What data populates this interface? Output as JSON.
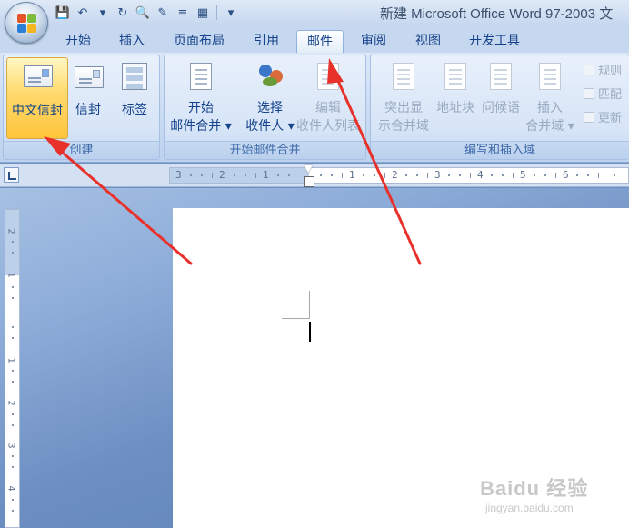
{
  "window": {
    "title": "新建 Microsoft Office Word 97-2003 文"
  },
  "quick_access": [
    {
      "icon": "save-icon",
      "glyph": "💾"
    },
    {
      "icon": "undo-icon",
      "glyph": "↶"
    },
    {
      "icon": "dropdown-arrow-icon",
      "glyph": "▾"
    },
    {
      "icon": "redo-icon",
      "glyph": "↻"
    },
    {
      "icon": "print-preview-icon",
      "glyph": "🔍"
    },
    {
      "icon": "edit-icon",
      "glyph": "✎"
    },
    {
      "icon": "align-icon",
      "glyph": "≡"
    },
    {
      "icon": "table-icon",
      "glyph": "▦"
    },
    {
      "icon": "customize-icon",
      "glyph": "▾"
    }
  ],
  "tabs": [
    {
      "label": "开始"
    },
    {
      "label": "插入"
    },
    {
      "label": "页面布局"
    },
    {
      "label": "引用"
    },
    {
      "label": "邮件",
      "active": true
    },
    {
      "label": "审阅"
    },
    {
      "label": "视图"
    },
    {
      "label": "开发工具"
    }
  ],
  "ribbon": {
    "create": {
      "label": "创建",
      "chinese_envelope": "中文信封",
      "envelope": "信封",
      "labels": "标签"
    },
    "start_merge": {
      "label": "开始邮件合并",
      "start_line1": "开始",
      "start_line2": "邮件合并",
      "select_line1": "选择",
      "select_line2": "收件人",
      "edit_line1": "编辑",
      "edit_line2": "收件人列表"
    },
    "write_insert": {
      "label": "编写和插入域",
      "highlight_line1": "突出显",
      "highlight_line2": "示合并域",
      "address_block": "地址块",
      "greeting_line": "问候语",
      "insert_line1": "插入",
      "insert_line2": "合并域",
      "rules": "规则",
      "match_fields": "匹配",
      "update_labels": "更新"
    }
  },
  "ruler": {
    "h_numbers": [
      "3",
      "2",
      "1",
      "1",
      "2",
      "3",
      "4",
      "5",
      "6"
    ],
    "v_numbers": [
      "2",
      "1",
      "1",
      "2",
      "3",
      "4"
    ]
  },
  "watermark": {
    "brand": "Baidu 经验",
    "url": "jingyan.baidu.com"
  },
  "colors": {
    "annotation_arrow": "#e8312b",
    "highlight_button": "#ffc53c",
    "ribbon_text": "#15428b"
  }
}
